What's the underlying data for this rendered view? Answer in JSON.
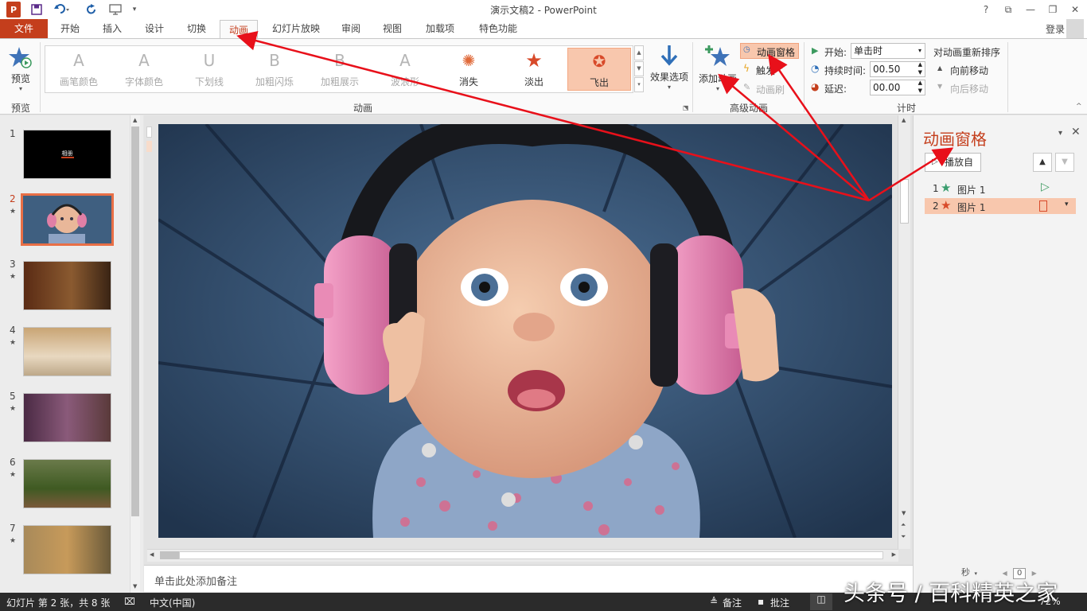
{
  "app": {
    "title": "演示文稿2 - PowerPoint",
    "login": "登录"
  },
  "qat": {
    "app_icon": "P",
    "save_icon": "save-icon",
    "undo_icon": "undo-icon",
    "redo_icon": "repeat-icon",
    "start_icon": "present-icon",
    "customize_icon": "chevron-down-icon"
  },
  "window": {
    "help": "?",
    "restore": "⧉",
    "minimize": "—",
    "maximize": "❐",
    "close": "✕"
  },
  "tabs": [
    "开始",
    "插入",
    "设计",
    "切换",
    "动画",
    "幻灯片放映",
    "审阅",
    "视图",
    "加载项",
    "特色功能"
  ],
  "file_tab": "文件",
  "ribbon": {
    "preview": {
      "label": "预览",
      "group": "预览"
    },
    "animation_group_label": "动画",
    "animations": [
      {
        "label": "画笔颜色",
        "glyph": "A",
        "enabled": false
      },
      {
        "label": "字体颜色",
        "glyph": "A",
        "enabled": false
      },
      {
        "label": "下划线",
        "glyph": "U",
        "enabled": false
      },
      {
        "label": "加粗闪烁",
        "glyph": "B",
        "enabled": false
      },
      {
        "label": "加粗展示",
        "glyph": "B",
        "enabled": false
      },
      {
        "label": "波浪形",
        "glyph": "A",
        "enabled": false
      },
      {
        "label": "消失",
        "glyph": "✺",
        "enabled": true
      },
      {
        "label": "淡出",
        "glyph": "★",
        "enabled": true
      },
      {
        "label": "飞出",
        "glyph": "✪",
        "enabled": true,
        "selected": true
      }
    ],
    "effect_options": "效果选项",
    "advanced": {
      "group": "高级动画",
      "add_animation": "添加动画",
      "animation_pane": "动画窗格",
      "trigger": "触发",
      "painter": "动画刷"
    },
    "timing": {
      "group": "计时",
      "start_label": "开始:",
      "start_value": "单击时",
      "duration_label": "持续时间:",
      "duration_value": "00.50",
      "delay_label": "延迟:",
      "delay_value": "00.00",
      "reorder": "对动画重新排序",
      "move_earlier": "向前移动",
      "move_later": "向后移动"
    }
  },
  "thumbnails": [
    {
      "num": "1",
      "star": "",
      "caption": "相册",
      "bg": "#000000"
    },
    {
      "num": "2",
      "star": "★",
      "caption": "",
      "bg": "#3f5f80",
      "selected": true
    },
    {
      "num": "3",
      "star": "★",
      "caption": "",
      "bg": "#6b3a1c"
    },
    {
      "num": "4",
      "star": "★",
      "caption": "",
      "bg": "#b98a5a"
    },
    {
      "num": "5",
      "star": "★",
      "caption": "",
      "bg": "#6a3f66"
    },
    {
      "num": "6",
      "star": "★",
      "caption": "",
      "bg": "#4a5a2a"
    },
    {
      "num": "7",
      "star": "★",
      "caption": "",
      "bg": "#8a6a3a"
    }
  ],
  "notes_placeholder": "单击此处添加备注",
  "animation_pane": {
    "title": "动画窗格",
    "play_button": "播放自",
    "items": [
      {
        "index": "1",
        "name": "图片 1",
        "star_color": "#3a9d6e"
      },
      {
        "index": "2",
        "name": "图片 1",
        "star_color": "#d84a2a",
        "selected": true
      }
    ],
    "seconds_label": "秒",
    "zoom_value": "0"
  },
  "status": {
    "slide_info": "幻灯片 第 2 张，共 8 张",
    "language": "中文(中国)",
    "notes": "备注",
    "comments": "批注",
    "zoom": "72%"
  },
  "watermark": "头条号 / 百科精英之家",
  "colors": {
    "accent": "#c43e1c",
    "selected_fill": "#f8c7ad",
    "annotation_arrow": "#e8101a"
  }
}
